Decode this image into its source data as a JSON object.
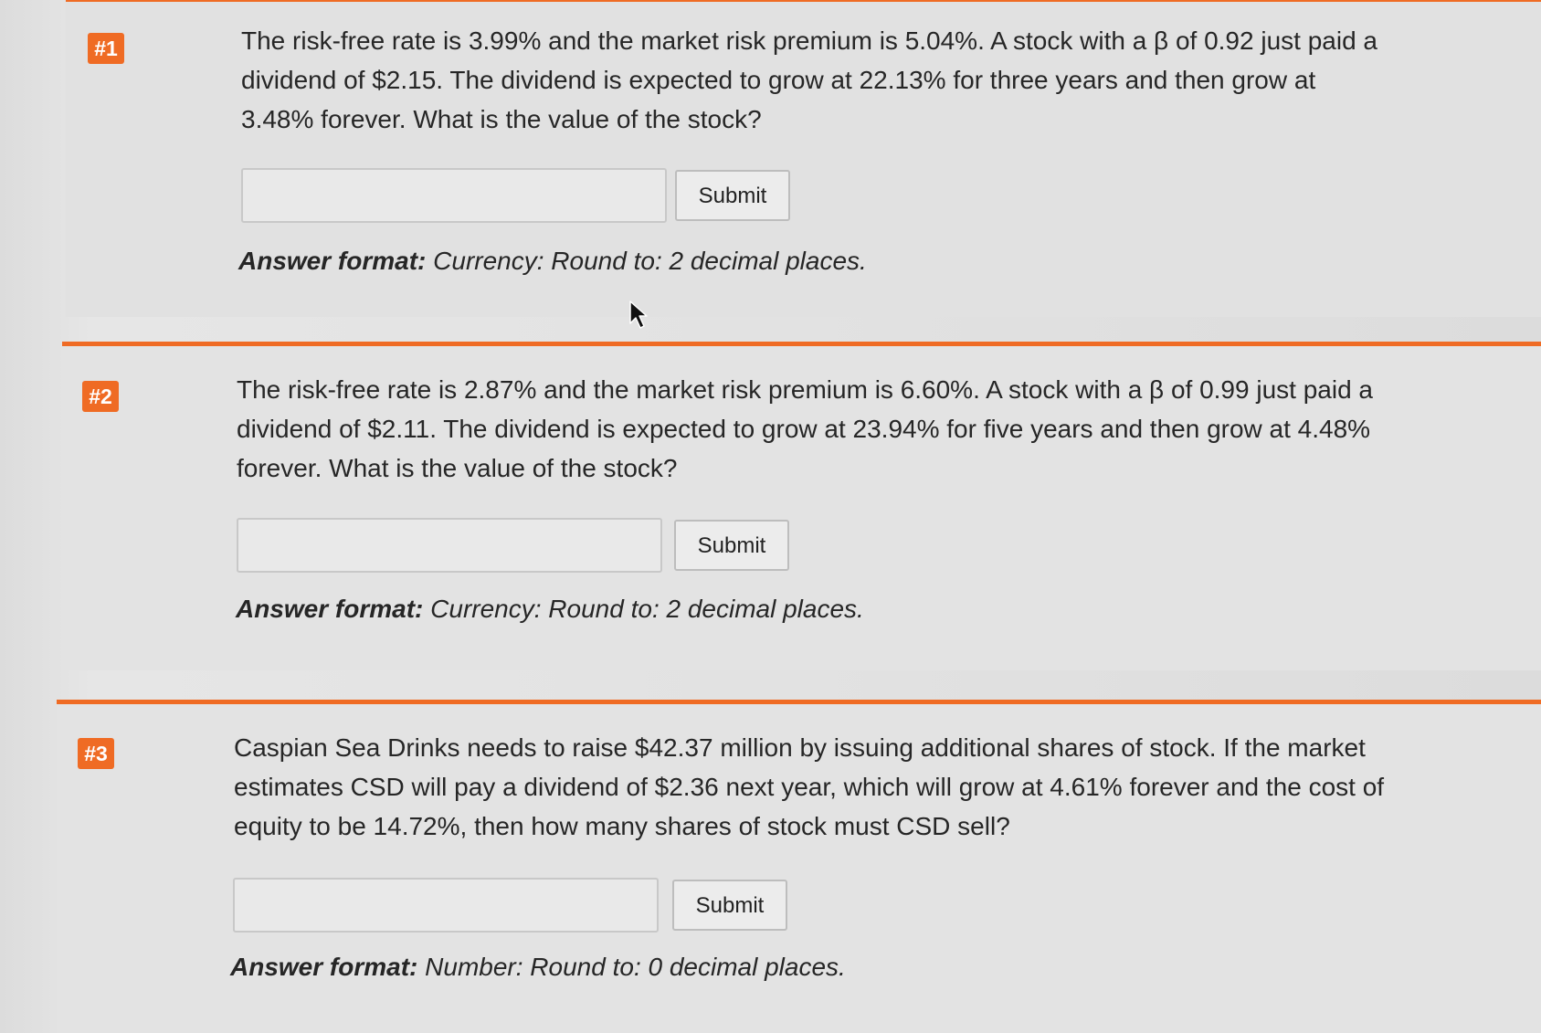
{
  "questions": [
    {
      "badge": "#1",
      "text": "The risk-free rate is 3.99% and the market risk premium is 5.04%. A stock with a β of 0.92 just paid a dividend of $2.15. The dividend is expected to grow at 22.13% for three years and then grow at 3.48% forever. What is the value of the stock?",
      "input_value": "",
      "submit_label": "Submit",
      "answer_format_label": "Answer format:",
      "answer_format_value": "Currency: Round to: 2 decimal places."
    },
    {
      "badge": "#2",
      "text": "The risk-free rate is 2.87% and the market risk premium is 6.60%. A stock with a β of 0.99 just paid a dividend of $2.11. The dividend is expected to grow at 23.94% for five years and then grow at 4.48% forever. What is the value of the stock?",
      "input_value": "",
      "submit_label": "Submit",
      "answer_format_label": "Answer format:",
      "answer_format_value": "Currency: Round to: 2 decimal places."
    },
    {
      "badge": "#3",
      "text": "Caspian Sea Drinks needs to raise $42.37 million by issuing additional shares of stock. If the market estimates CSD will pay a dividend of $2.36 next year, which will grow at 4.61% forever and the cost of equity to be 14.72%, then how many shares of stock must CSD sell?",
      "input_value": "",
      "submit_label": "Submit",
      "answer_format_label": "Answer format:",
      "answer_format_value": "Number: Round to: 0 decimal places."
    }
  ],
  "colors": {
    "accent": "#ef6b24",
    "panel_bg": "#e3e3e3"
  },
  "cursor": {
    "icon": "mouse-pointer-icon"
  }
}
